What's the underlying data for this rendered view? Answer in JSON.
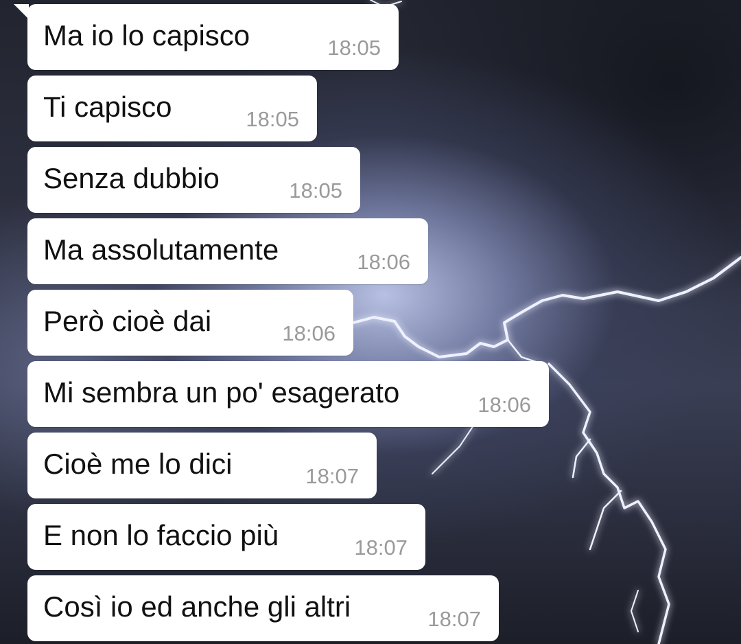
{
  "chat": {
    "messages": [
      {
        "text": "Ma io lo capisco",
        "time": "18:05"
      },
      {
        "text": "Ti capisco",
        "time": "18:05"
      },
      {
        "text": "Senza dubbio",
        "time": "18:05"
      },
      {
        "text": "Ma assolutamente",
        "time": "18:06"
      },
      {
        "text": "Però cioè dai",
        "time": "18:06"
      },
      {
        "text": "Mi sembra un po' esagerato",
        "time": "18:06"
      },
      {
        "text": "Cioè me lo dici",
        "time": "18:07"
      },
      {
        "text": "E non lo faccio più",
        "time": "18:07"
      },
      {
        "text": "Così io ed anche gli altri",
        "time": "18:07"
      }
    ]
  },
  "colors": {
    "bubble_background": "#ffffff",
    "message_text": "#111111",
    "timestamp_text": "#9a9a9a"
  }
}
